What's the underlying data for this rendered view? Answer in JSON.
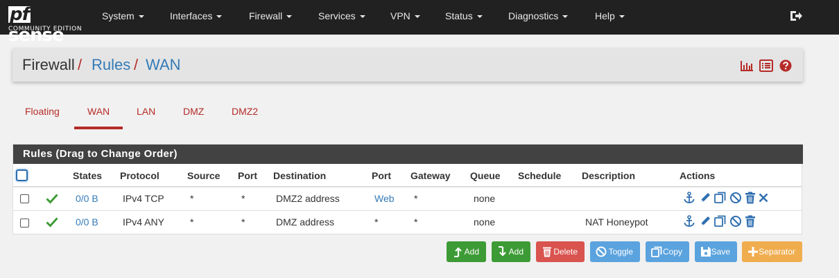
{
  "brand": {
    "logo_pf": "pf",
    "logo_sense": "sense",
    "edition": "COMMUNITY EDITION"
  },
  "nav": {
    "items": [
      {
        "label": "System"
      },
      {
        "label": "Interfaces"
      },
      {
        "label": "Firewall"
      },
      {
        "label": "Services"
      },
      {
        "label": "VPN"
      },
      {
        "label": "Status"
      },
      {
        "label": "Diagnostics"
      },
      {
        "label": "Help"
      }
    ],
    "logout_icon": "sign-out-icon"
  },
  "breadcrumb": {
    "root": "Firewall",
    "sep": "/",
    "rules": "Rules",
    "current": "WAN"
  },
  "header_icons": [
    "bar-chart-icon",
    "list-icon",
    "help-icon"
  ],
  "tabs": [
    {
      "label": "Floating",
      "active": false
    },
    {
      "label": "WAN",
      "active": true
    },
    {
      "label": "LAN",
      "active": false
    },
    {
      "label": "DMZ",
      "active": false
    },
    {
      "label": "DMZ2",
      "active": false
    }
  ],
  "panel": {
    "title": "Rules (Drag to Change Order)",
    "columns": [
      "States",
      "Protocol",
      "Source",
      "Port",
      "Destination",
      "Port",
      "Gateway",
      "Queue",
      "Schedule",
      "Description",
      "Actions"
    ],
    "rows": [
      {
        "states": "0/0 B",
        "protocol": "IPv4 TCP",
        "source": "*",
        "port": "*",
        "destination": "DMZ2 address",
        "dest_port": "Web",
        "gateway": "*",
        "queue": "none",
        "schedule": "",
        "description": ""
      },
      {
        "states": "0/0 B",
        "protocol": "IPv4 ANY",
        "source": "*",
        "port": "*",
        "destination": "DMZ address",
        "dest_port": "*",
        "gateway": "*",
        "queue": "none",
        "schedule": "",
        "description": "NAT Honeypot"
      }
    ]
  },
  "buttons": {
    "add_top": "Add",
    "add_bottom": "Add",
    "delete": "Delete",
    "toggle": "Toggle",
    "copy": "Copy",
    "save": "Save",
    "separator": "Separator"
  },
  "colors": {
    "topbar": "#212121",
    "accent": "#b52b27",
    "link": "#337ab7",
    "panel_head": "#424242"
  }
}
